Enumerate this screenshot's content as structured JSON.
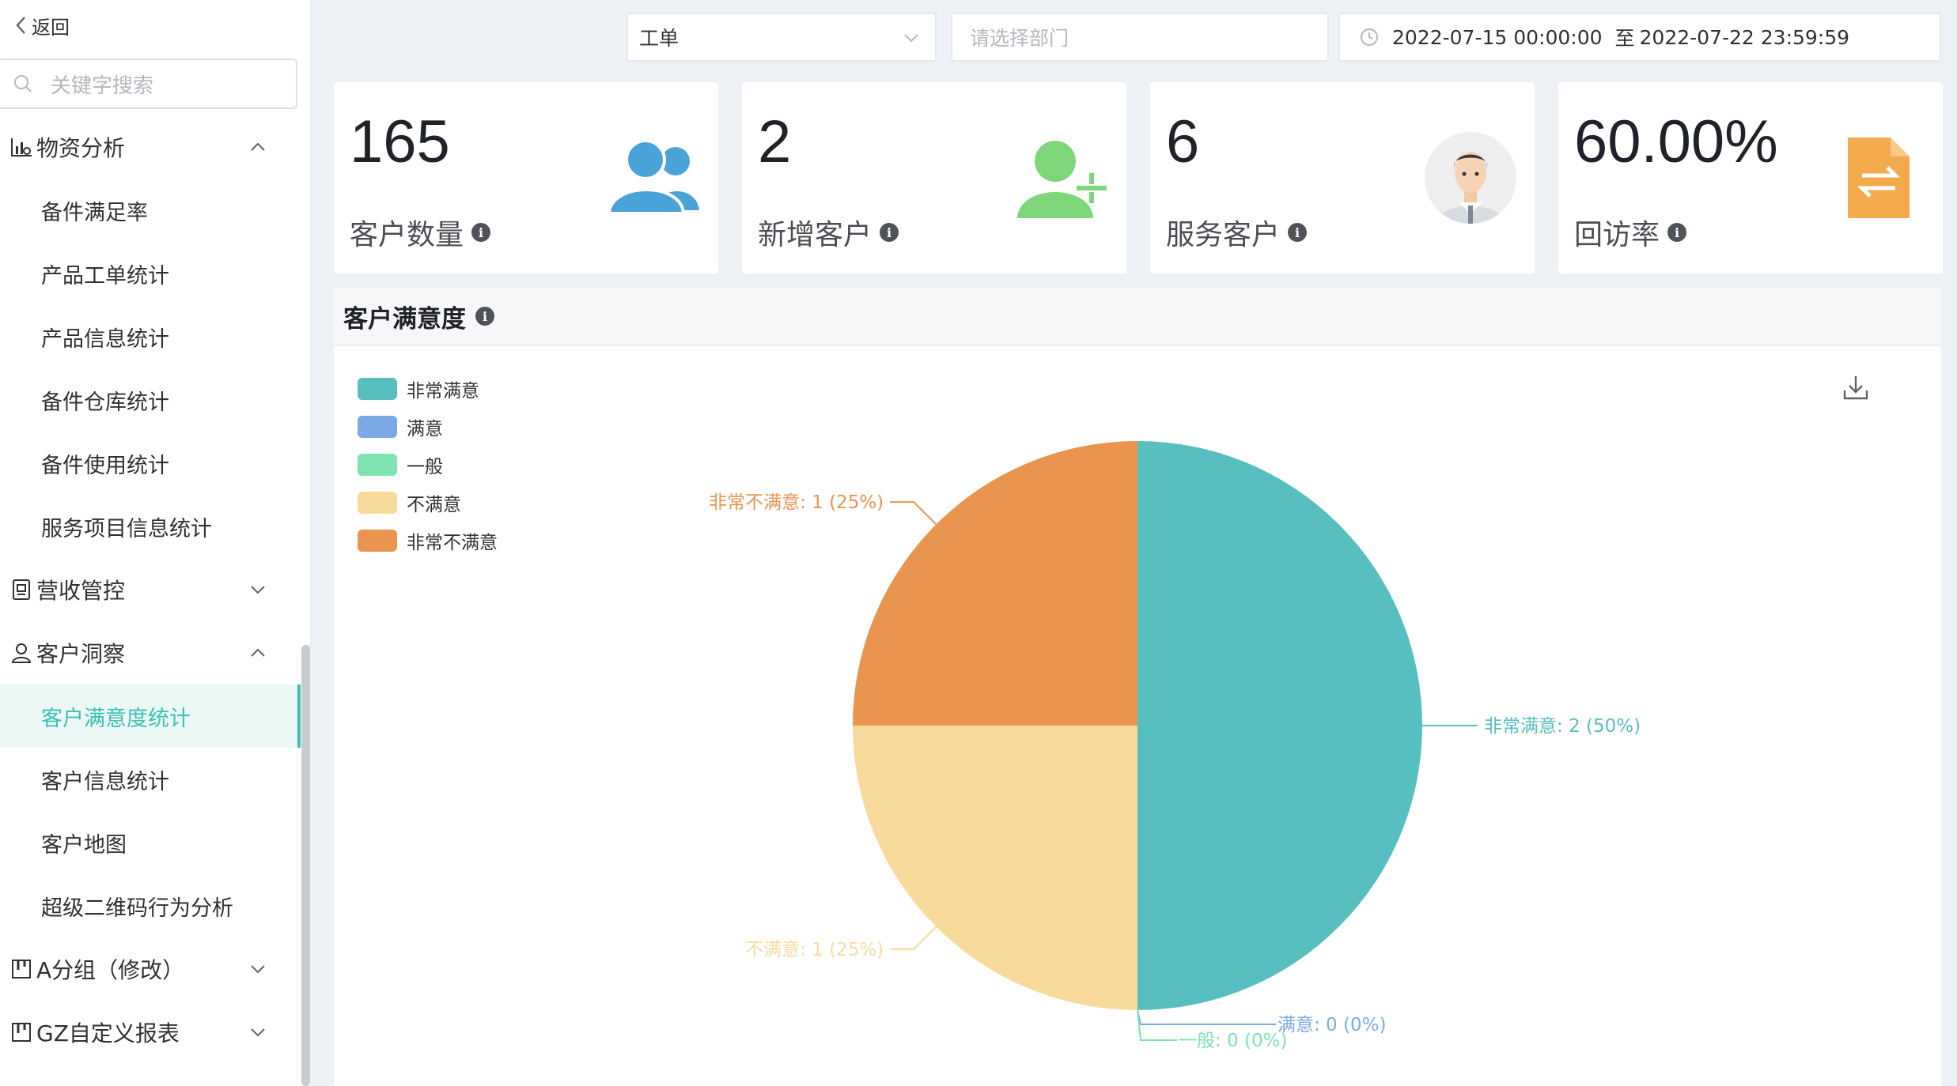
{
  "sidebar": {
    "back_label": "返回",
    "search_placeholder": "关键字搜索",
    "groups": [
      {
        "label": "物资分析",
        "items": [
          "备件满足率",
          "产品工单统计",
          "产品信息统计",
          "备件仓库统计",
          "备件使用统计",
          "服务项目信息统计"
        ]
      },
      {
        "label": "营收管控"
      },
      {
        "label": "客户洞察",
        "items": [
          "客户满意度统计",
          "客户信息统计",
          "客户地图",
          "超级二维码行为分析"
        ]
      },
      {
        "label": "A分组（修改）"
      },
      {
        "label": "GZ自定义报表"
      }
    ],
    "active_item": "客户满意度统计"
  },
  "filters": {
    "type_value": "工单",
    "dept_placeholder": "请选择部门",
    "date_start": "2022-07-15 00:00:00",
    "date_sep": "至",
    "date_end": "2022-07-22 23:59:59"
  },
  "stats": [
    {
      "value": "165",
      "label": "客户数量",
      "icon": "users-icon",
      "color": "#4aa3d8"
    },
    {
      "value": "2",
      "label": "新增客户",
      "icon": "add-user-icon",
      "color": "#7fd67a"
    },
    {
      "value": "6",
      "label": "服务客户",
      "icon": "service-person-icon"
    },
    {
      "value": "60.00%",
      "label": "回访率",
      "icon": "document-exchange-icon",
      "color": "#f2aa4c"
    }
  ],
  "panel": {
    "title": "客户满意度",
    "download_icon": "download-icon"
  },
  "chart_data": {
    "type": "pie",
    "title": "客户满意度",
    "categories": [
      "非常满意",
      "满意",
      "一般",
      "不满意",
      "非常不满意"
    ],
    "values": [
      2,
      0,
      0,
      1,
      1
    ],
    "colors": [
      "#57bfbf",
      "#7aa9e6",
      "#7ee3b1",
      "#f8db9b",
      "#e9954f"
    ],
    "data_labels": [
      "非常满意:  2 (50%)",
      "满意:  0 (0%)",
      "一般:  0 (0%)",
      "不满意:  1 (25%)",
      "非常不满意:  1 (25%)"
    ],
    "legend_position": "top-left"
  }
}
